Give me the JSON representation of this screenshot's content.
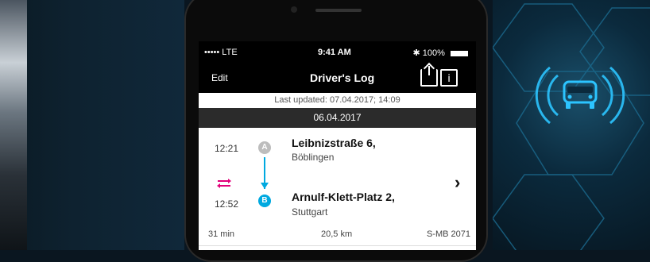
{
  "status_bar": {
    "carrier": "••••• LTE",
    "time": "9:41 AM",
    "battery": "100%"
  },
  "nav": {
    "edit_label": "Edit",
    "title": "Driver's Log",
    "share_icon": "share-icon",
    "info_icon": "info-icon"
  },
  "last_updated": "Last updated: 07.04.2017; 14:09",
  "date_header": "06.04.2017",
  "trip": {
    "start_time": "12:21",
    "end_time": "12:52",
    "marker_a": "A",
    "marker_b": "B",
    "start_street": "Leibnizstraße 6,",
    "start_city": "Böblingen",
    "end_street": "Arnulf-Klett-Platz 2,",
    "end_city": "Stuttgart",
    "duration": "31 min",
    "distance": "20,5 km",
    "plate": "S-MB 2071"
  },
  "colors": {
    "accent_blue": "#00a9e0",
    "swap_pink": "#e2007a"
  }
}
